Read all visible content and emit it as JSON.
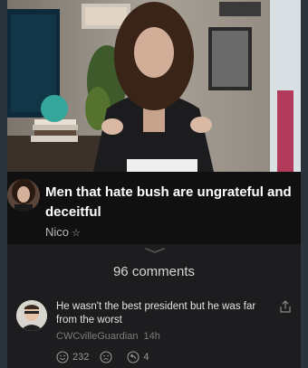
{
  "video": {
    "title": "Men that hate bush are ungrateful and deceitful",
    "author": "Nico",
    "author_badge": "☆"
  },
  "comments": {
    "count_label": "96 comments",
    "items": [
      {
        "text": "He wasn't the best president but he was far from the worst",
        "username": "CWCvilleGuardian",
        "time": "14h",
        "likes": "232",
        "replies": "4"
      }
    ]
  },
  "icons": {
    "share": "share-icon",
    "smile": "smile-icon",
    "neutral": "neutral-face-icon",
    "reply": "reply-icon",
    "star": "star-icon"
  }
}
